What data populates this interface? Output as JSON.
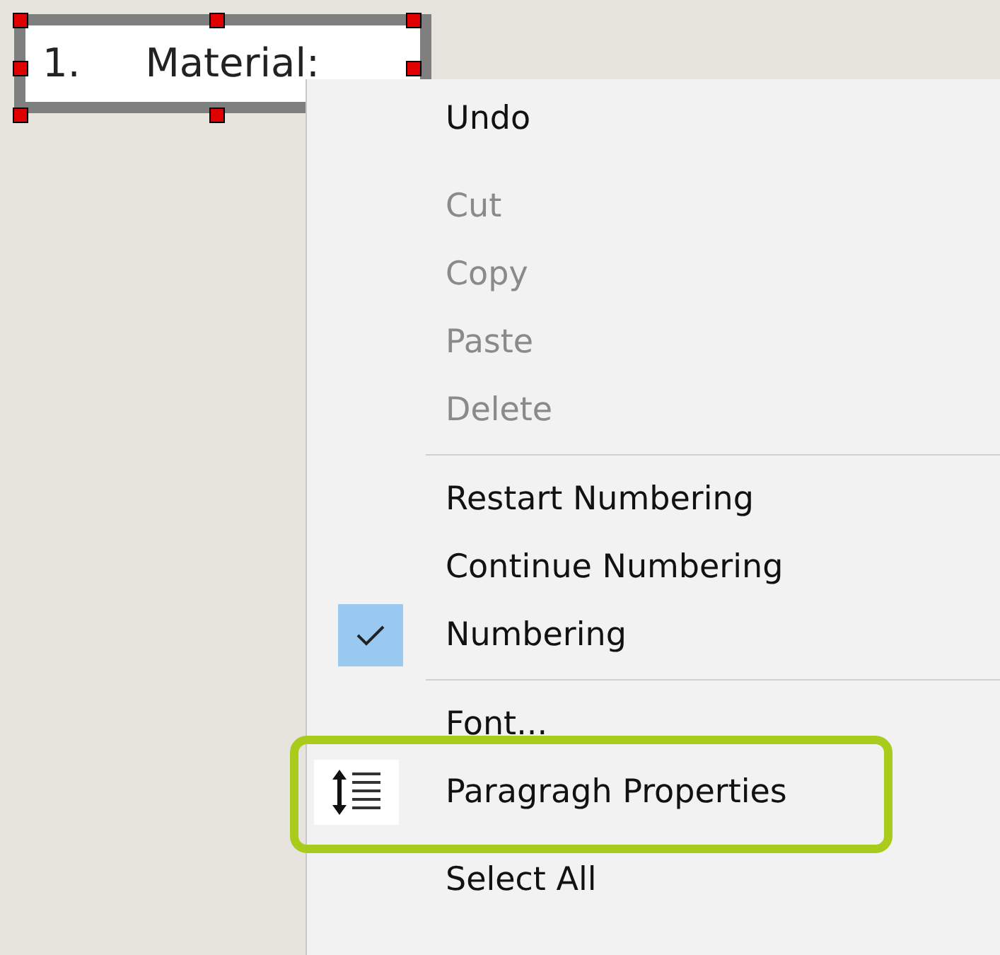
{
  "text_box": {
    "number": "1.",
    "text": "Material:"
  },
  "context_menu": {
    "items": [
      {
        "kind": "item",
        "label": "Undo",
        "disabled": false,
        "checked": false,
        "highlighted": false
      },
      {
        "kind": "spacer"
      },
      {
        "kind": "item",
        "label": "Cut",
        "disabled": true,
        "checked": false,
        "highlighted": false
      },
      {
        "kind": "item",
        "label": "Copy",
        "disabled": true,
        "checked": false,
        "highlighted": false
      },
      {
        "kind": "item",
        "label": "Paste",
        "disabled": true,
        "checked": false,
        "highlighted": false
      },
      {
        "kind": "item",
        "label": "Delete",
        "disabled": true,
        "checked": false,
        "highlighted": false
      },
      {
        "kind": "separator"
      },
      {
        "kind": "item",
        "label": "Restart Numbering",
        "disabled": false,
        "checked": false,
        "highlighted": false
      },
      {
        "kind": "item",
        "label": "Continue Numbering",
        "disabled": false,
        "checked": false,
        "highlighted": false
      },
      {
        "kind": "item",
        "label": "Numbering",
        "disabled": false,
        "checked": true,
        "highlighted": false
      },
      {
        "kind": "separator"
      },
      {
        "kind": "item",
        "label": "Font...",
        "disabled": false,
        "checked": false,
        "highlighted": false
      },
      {
        "kind": "icon_item",
        "label": "Paragragh Properties",
        "disabled": false,
        "checked": false,
        "highlighted": true
      },
      {
        "kind": "spacer"
      },
      {
        "kind": "item",
        "label": "Select All",
        "disabled": false,
        "checked": false,
        "highlighted": false
      }
    ]
  }
}
